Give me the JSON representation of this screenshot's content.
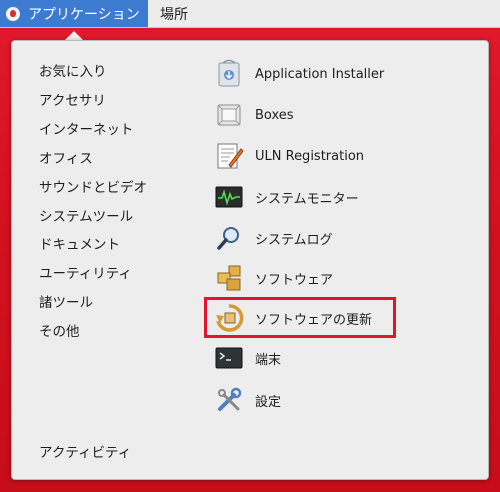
{
  "topbar": {
    "applications_label": "アプリケーション",
    "places_label": "場所"
  },
  "categories": [
    "お気に入り",
    "アクセサリ",
    "インターネット",
    "オフィス",
    "サウンドとビデオ",
    "システムツール",
    "ドキュメント",
    "ユーティリティ",
    "諸ツール",
    "その他"
  ],
  "activities_label": "アクティビティ",
  "apps": [
    {
      "label": "Application Installer",
      "icon": "package-installer-icon"
    },
    {
      "label": "Boxes",
      "icon": "boxes-icon"
    },
    {
      "label": "ULN Registration",
      "icon": "registration-icon"
    },
    {
      "label": "システムモニター",
      "icon": "system-monitor-icon"
    },
    {
      "label": "システムログ",
      "icon": "system-log-icon"
    },
    {
      "label": "ソフトウェア",
      "icon": "software-icon"
    },
    {
      "label": "ソフトウェアの更新",
      "icon": "software-update-icon"
    },
    {
      "label": "端末",
      "icon": "terminal-icon"
    },
    {
      "label": "設定",
      "icon": "settings-icon"
    }
  ],
  "highlighted_app": "ソフトウェアの更新",
  "colors": {
    "accent": "#3d7bd1",
    "background_red": "#d3111f",
    "highlight_border": "#e3142b",
    "menu_bg": "#ededed"
  }
}
